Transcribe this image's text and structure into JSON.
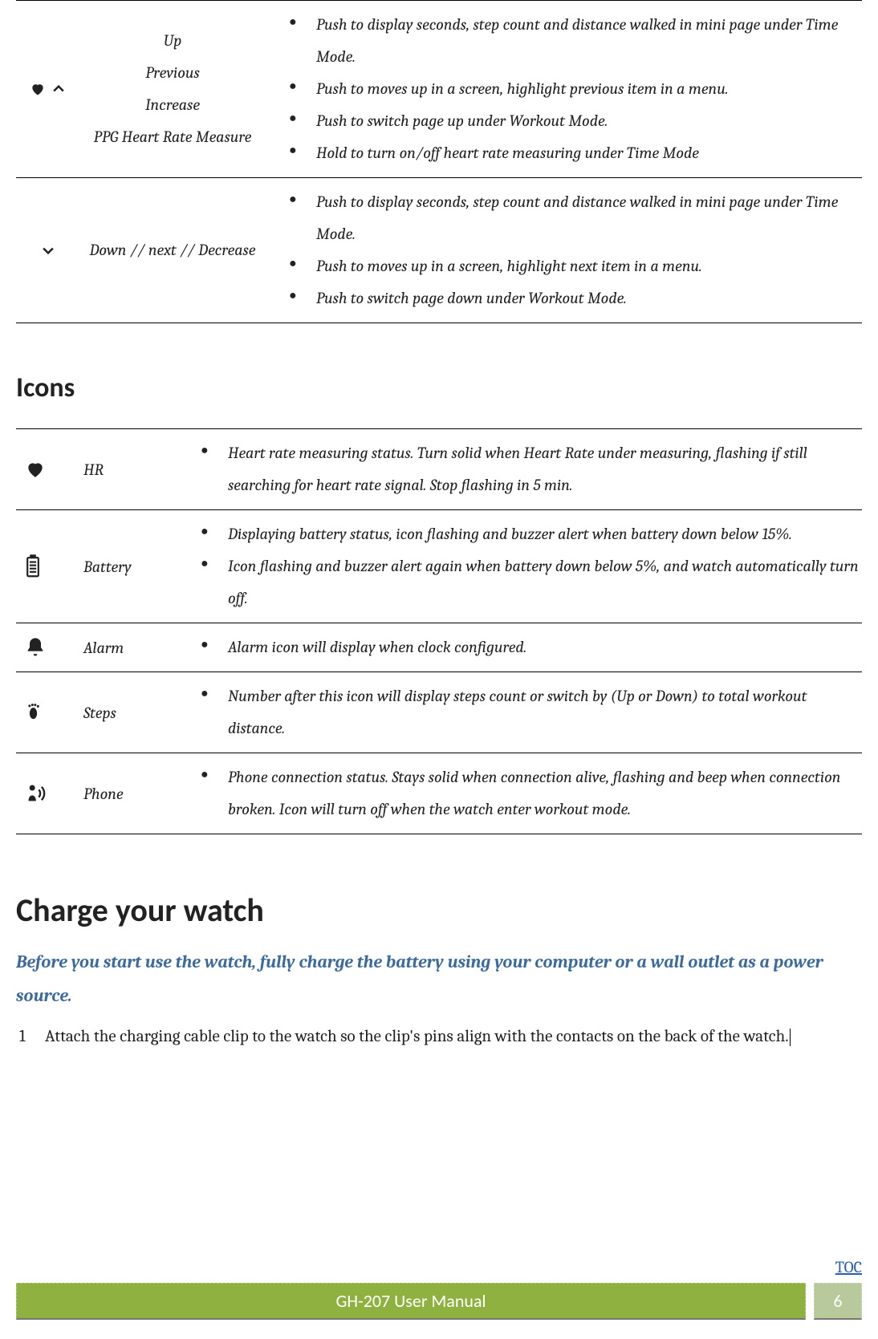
{
  "buttons_table": {
    "rows": [
      {
        "label_lines": [
          "Up",
          "Previous",
          "Increase",
          "PPG Heart Rate Measure"
        ],
        "desc": [
          "Push to display seconds, step count and distance walked in mini page under Time Mode.",
          "Push to moves up in a screen, highlight previous item in a menu.",
          "Push to switch page up under Workout Mode.",
          "Hold to turn on/off heart rate measuring under Time Mode"
        ]
      },
      {
        "label_lines": [
          "Down // next // Decrease"
        ],
        "desc": [
          "Push to display seconds, step count and distance walked in mini page under Time Mode.",
          "Push to moves up in a screen, highlight next item in a menu.",
          "Push to switch page down under Workout Mode."
        ]
      }
    ]
  },
  "icons_heading": "Icons",
  "icons_table": {
    "rows": [
      {
        "name": "HR",
        "desc": [
          "Heart rate measuring status. Turn solid when Heart Rate under measuring, flashing if still searching for heart rate signal. Stop flashing in 5 min."
        ]
      },
      {
        "name": "Battery",
        "desc": [
          "Displaying battery status, icon flashing and buzzer alert when battery down below 15%.",
          "Icon flashing and buzzer alert again when battery down below 5%, and watch automatically turn off."
        ]
      },
      {
        "name": "Alarm",
        "desc": [
          "Alarm icon will display when clock configured."
        ]
      },
      {
        "name": "Steps",
        "desc": [
          "Number after this icon will display steps count or switch by (Up or Down) to total workout distance."
        ]
      },
      {
        "name": "Phone",
        "desc": [
          "Phone connection status. Stays solid when connection alive, flashing and beep when connection broken. Icon will turn off when the watch enter workout mode."
        ]
      }
    ]
  },
  "charge_heading": "Charge your watch",
  "charge_intro": "Before you start use the watch, fully charge the battery using your computer or a wall outlet as a power source.",
  "charge_steps": [
    {
      "num": "1",
      "text": "Attach the charging cable clip to the watch so the clip's pins align with the contacts on the back of the watch."
    }
  ],
  "footer": {
    "toc": "TOC",
    "title": "GH-207 User Manual",
    "page": "6"
  }
}
